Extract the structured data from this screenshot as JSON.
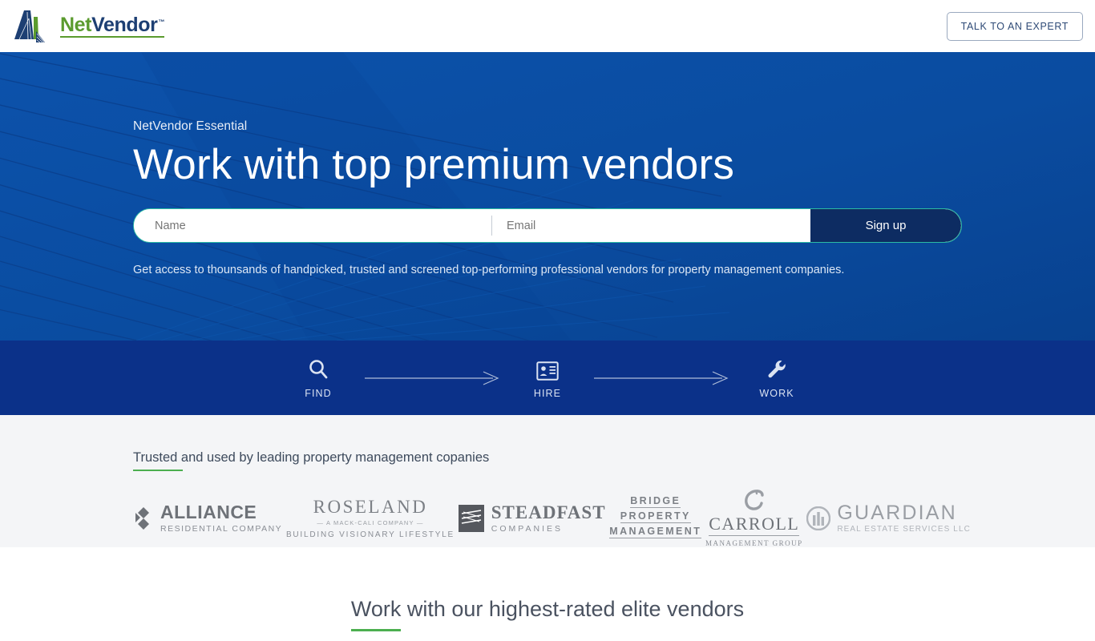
{
  "header": {
    "logo": {
      "part1": "Net",
      "part2": "Vendor",
      "tm": "™",
      "icon": "netvendor-bridge-logo"
    },
    "cta_label": "TALK TO AN EXPERT"
  },
  "hero": {
    "eyebrow": "NetVendor Essential",
    "title": "Work with top premium vendors",
    "form": {
      "name_placeholder": "Name",
      "name_value": "",
      "email_placeholder": "Email",
      "email_value": "",
      "submit_label": "Sign up"
    },
    "subtext": "Get access to thounsands of handpicked, trusted and screened top-performing professional vendors for property management companies.",
    "bg_color": "#0a4da0",
    "accent_color": "#2bbba4",
    "button_color": "#0d2c62"
  },
  "process": {
    "bg_color": "#0b3189",
    "steps": [
      {
        "label": "FIND",
        "icon": "magnifier-icon"
      },
      {
        "label": "HIRE",
        "icon": "id-card-icon"
      },
      {
        "label": "WORK",
        "icon": "wrench-icon"
      }
    ]
  },
  "trusted": {
    "heading": "Trusted and used by leading property management copanies",
    "underline_color": "#4caf50",
    "bg_color": "#f4f5f7",
    "logos": [
      {
        "name": "alliance",
        "line1": "ALLIANCE",
        "line2": "RESIDENTIAL COMPANY"
      },
      {
        "name": "roseland",
        "line1": "ROSELAND",
        "line2": "— A MACK-CALI COMPANY —",
        "line3": "BUILDING VISIONARY LIFESTYLE"
      },
      {
        "name": "steadfast",
        "line1": "STEADFAST",
        "line2": "COMPANIES"
      },
      {
        "name": "bridge",
        "line1": "BRIDGE",
        "line2": "PROPERTY",
        "line3": "MANAGEMENT"
      },
      {
        "name": "carroll",
        "line1": "CARROLL",
        "line2": "MANAGEMENT GROUP"
      },
      {
        "name": "guardian",
        "line1": "GUARDIAN",
        "line2": "REAL ESTATE SERVICES LLC"
      }
    ]
  },
  "elite": {
    "heading": "Work with our highest-rated elite vendors",
    "underline_color": "#4caf50"
  }
}
